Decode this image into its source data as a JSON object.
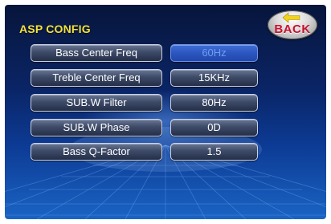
{
  "screen": {
    "title": "ASP CONFIG"
  },
  "back_button": {
    "label": "BACK",
    "icon": "back-arrow-icon"
  },
  "settings": [
    {
      "label": "Bass Center Freq",
      "value": "60Hz",
      "disabled": true
    },
    {
      "label": "Treble Center Freq",
      "value": "15KHz",
      "disabled": false
    },
    {
      "label": "SUB.W  Filter",
      "value": "80Hz",
      "disabled": false
    },
    {
      "label": "SUB.W  Phase",
      "value": "0D",
      "disabled": false
    },
    {
      "label": "Bass  Q-Factor",
      "value": "1.5",
      "disabled": false
    }
  ],
  "colors": {
    "title": "#f5e23a",
    "back_label": "#c8102e",
    "disabled_value_text": "#6f9ef0",
    "background_dark": "#07153b",
    "background_light": "#1a64c4"
  }
}
